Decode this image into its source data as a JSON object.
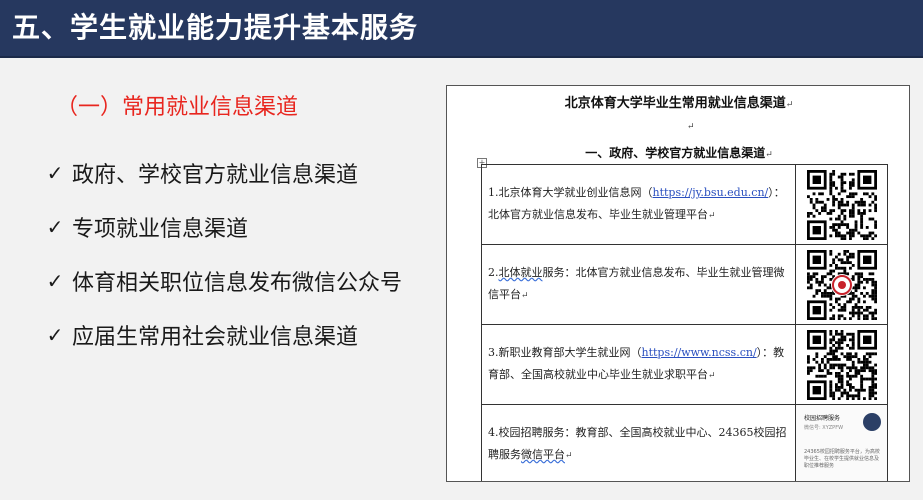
{
  "slide": {
    "title": "五、学生就业能力提升基本服务",
    "section_heading": "（一）常用就业信息渠道",
    "bullets": [
      "政府、学校官方就业信息渠道",
      "专项就业信息渠道",
      "体育相关职位信息发布微信公众号",
      "应届生常用社会就业信息渠道"
    ],
    "check_glyph": "✓"
  },
  "document": {
    "title": "北京体育大学毕业生常用就业信息渠道",
    "subtitle": "一、政府、学校官方就业信息渠道",
    "paragraph_mark": "↵",
    "table_handle_glyph": "+",
    "rows": [
      {
        "prefix": "1.北京体育大学就业创业信息网（",
        "link": "https://jy.bsu.edu.cn/",
        "suffix": "）：北体官方就业信息发布、毕业生就业管理平台",
        "qr_icon": "qr-code-icon"
      },
      {
        "prefix": "2.",
        "squiggle": "北体就业",
        "suffix": "服务：北体官方就业信息发布、毕业生就业管理微信平台",
        "qr_icon": "qr-code-logo-icon"
      },
      {
        "prefix": "3.新职业教育部大学生就业网（",
        "link": "https://www.ncss.cn/",
        "suffix": "）：教育部、全国高校就业中心毕业生就业求职平台",
        "qr_icon": "qr-code-icon"
      },
      {
        "prefix": "4.校园招聘服务：教育部、全国高校就业中心、24365校园招聘服务",
        "squiggle": "微信平台",
        "suffix": "",
        "card": {
          "name": "校园招聘服务",
          "sub": "微信号: XYZPFW",
          "desc": "24365校园招聘服务平台，为高校毕业生、在校学生提供就业信息及职位推荐服务"
        }
      }
    ]
  },
  "colors": {
    "title_bar": "#26385f",
    "heading_red": "#e8261f",
    "link_blue": "#2a4fbf",
    "background": "#f2f2f2"
  }
}
